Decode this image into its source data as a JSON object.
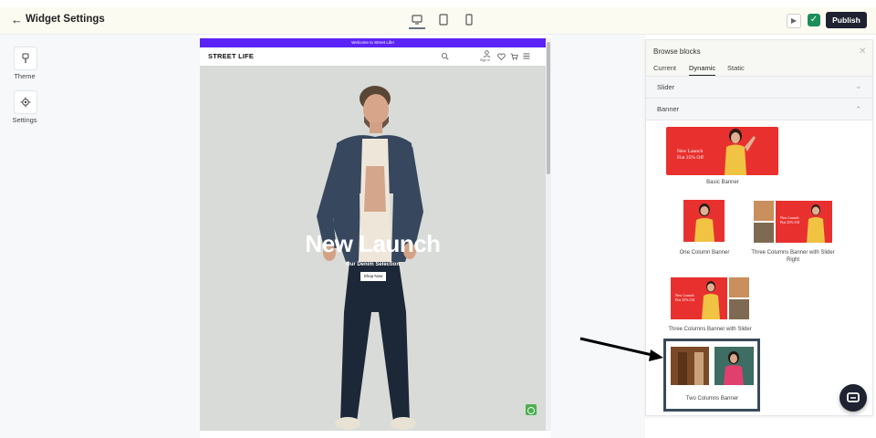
{
  "header": {
    "back_glyph": "←",
    "title": "Widget Settings",
    "device_icons": [
      "desktop-icon",
      "tablet-icon",
      "mobile-icon"
    ],
    "publish_label": "Publish"
  },
  "left_rail": {
    "items": [
      {
        "label": "Theme",
        "icon": "brush-icon"
      },
      {
        "label": "Settings",
        "icon": "gear-icon"
      }
    ]
  },
  "preview": {
    "promo_text": "Welcome to Street Life!",
    "store_name": "STREET LIFE",
    "account_label": "Sign in",
    "hero_title": "New Launch",
    "hero_subtitle": "Our Denim Selection",
    "hero_button": "Shop Now"
  },
  "panel": {
    "title": "Browse blocks",
    "tabs": [
      "Current",
      "Dynamic",
      "Static"
    ],
    "active_tab": "Dynamic",
    "sections": {
      "slider": "Slider",
      "banner": "Banner"
    },
    "banner_text": {
      "line1": "New Launch",
      "line2": "Flat 25% Off"
    },
    "blocks": [
      {
        "label": "Basic Banner"
      },
      {
        "label": "One Column Banner"
      },
      {
        "label": "Three Columns Banner with Slider Right"
      },
      {
        "label": "Three Columns Banner with Slider"
      },
      {
        "label": "Two Columns Banner"
      }
    ]
  },
  "colors": {
    "promo_bar": "#5b23f5",
    "banner_red": "#e8312f",
    "publish_bg": "#1e2231",
    "check_green": "#1b8e5a",
    "highlight_border": "#3a4a5c"
  }
}
